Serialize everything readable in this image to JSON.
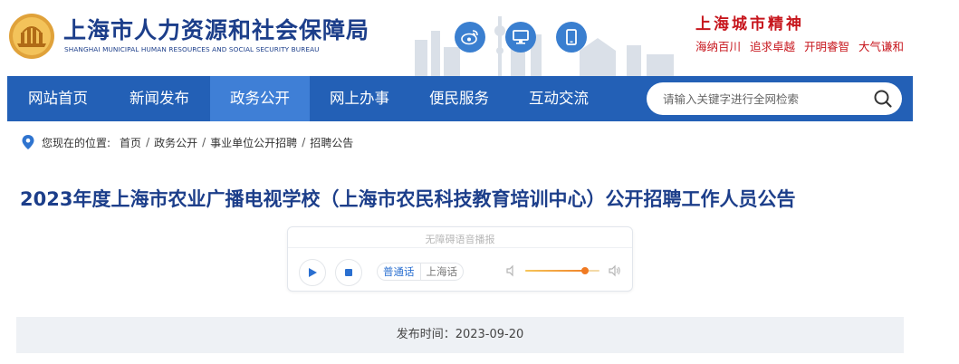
{
  "header": {
    "title_cn": "上海市人力资源和社会保障局",
    "title_en": "SHANGHAI MUNICIPAL HUMAN RESOURCES AND SOCIAL SECURITY BUREAU",
    "icons": [
      "weibo-icon",
      "desktop-icon",
      "mobile-icon"
    ],
    "spirit_title": "上海城市精神",
    "spirit_tags": [
      "海纳百川",
      "追求卓越",
      "开明睿智",
      "大气谦和"
    ]
  },
  "nav": {
    "items": [
      "网站首页",
      "新闻发布",
      "政务公开",
      "网上办事",
      "便民服务",
      "互动交流"
    ],
    "active_index": 2,
    "search_placeholder": "请输入关键字进行全网检索"
  },
  "breadcrumb": {
    "label": "您现在的位置:",
    "crumbs": [
      "首页",
      "政务公开",
      "事业单位公开招聘",
      "招聘公告"
    ]
  },
  "article": {
    "title": "2023年度上海市农业广播电视学校（上海市农民科技教育培训中心）公开招聘工作人员公告"
  },
  "player": {
    "label": "无障碍语音播报",
    "voice_options": [
      "普通话",
      "上海话"
    ],
    "selected_voice": "普通话",
    "volume_level": 0.8
  },
  "meta": {
    "publish_label": "发布时间：",
    "publish_date": "2023-09-20"
  },
  "colors": {
    "brand_blue": "#1c3e8a",
    "nav_blue": "#2360b6",
    "nav_active": "#3f7fd6",
    "spirit_red": "#c7161d",
    "icon_blue": "#3a7fd0",
    "volume_orange": "#f07a22"
  }
}
